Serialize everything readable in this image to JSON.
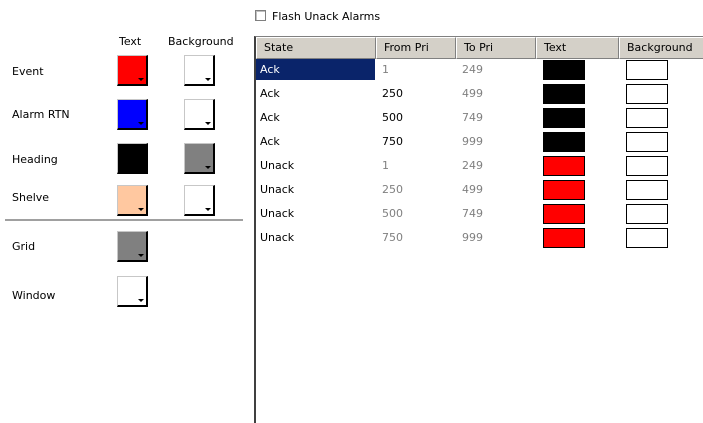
{
  "flash": {
    "label": "Flash Unack Alarms",
    "checked": false
  },
  "left_panel": {
    "col_text": "Text",
    "col_background": "Background",
    "rows": [
      {
        "label": "Event",
        "text_color": "#ff0000",
        "bg_color": "#ffffff"
      },
      {
        "label": "Alarm RTN",
        "text_color": "#0000ff",
        "bg_color": "#ffffff"
      },
      {
        "label": "Heading",
        "text_color": "#000000",
        "bg_color": "#808080"
      },
      {
        "label": "Shelve",
        "text_color": "#ffc8a0",
        "bg_color": "#ffffff"
      },
      {
        "label": "Grid",
        "text_color": "#808080"
      },
      {
        "label": "Window",
        "text_color": "#ffffff"
      }
    ]
  },
  "table": {
    "columns": [
      "State",
      "From Pri",
      "To Pri",
      "Text",
      "Background"
    ],
    "rows": [
      {
        "state": "Ack",
        "from": "1",
        "to": "249",
        "text_color": "#000000",
        "bg_color": "#ffffff",
        "selected": true,
        "from_gray": true
      },
      {
        "state": "Ack",
        "from": "250",
        "to": "499",
        "text_color": "#000000",
        "bg_color": "#ffffff",
        "selected": false,
        "from_gray": false
      },
      {
        "state": "Ack",
        "from": "500",
        "to": "749",
        "text_color": "#000000",
        "bg_color": "#ffffff",
        "selected": false,
        "from_gray": false
      },
      {
        "state": "Ack",
        "from": "750",
        "to": "999",
        "text_color": "#000000",
        "bg_color": "#ffffff",
        "selected": false,
        "from_gray": false
      },
      {
        "state": "Unack",
        "from": "1",
        "to": "249",
        "text_color": "#ff0000",
        "bg_color": "#ffffff",
        "selected": false,
        "from_gray": true
      },
      {
        "state": "Unack",
        "from": "250",
        "to": "499",
        "text_color": "#ff0000",
        "bg_color": "#ffffff",
        "selected": false,
        "from_gray": true
      },
      {
        "state": "Unack",
        "from": "500",
        "to": "749",
        "text_color": "#ff0000",
        "bg_color": "#ffffff",
        "selected": false,
        "from_gray": true
      },
      {
        "state": "Unack",
        "from": "750",
        "to": "999",
        "text_color": "#ff0000",
        "bg_color": "#ffffff",
        "selected": false,
        "from_gray": true
      }
    ]
  },
  "colors": {
    "header_bg": "#d4d0c8",
    "selection": "#0a246a",
    "disabled_text": "#808080"
  }
}
